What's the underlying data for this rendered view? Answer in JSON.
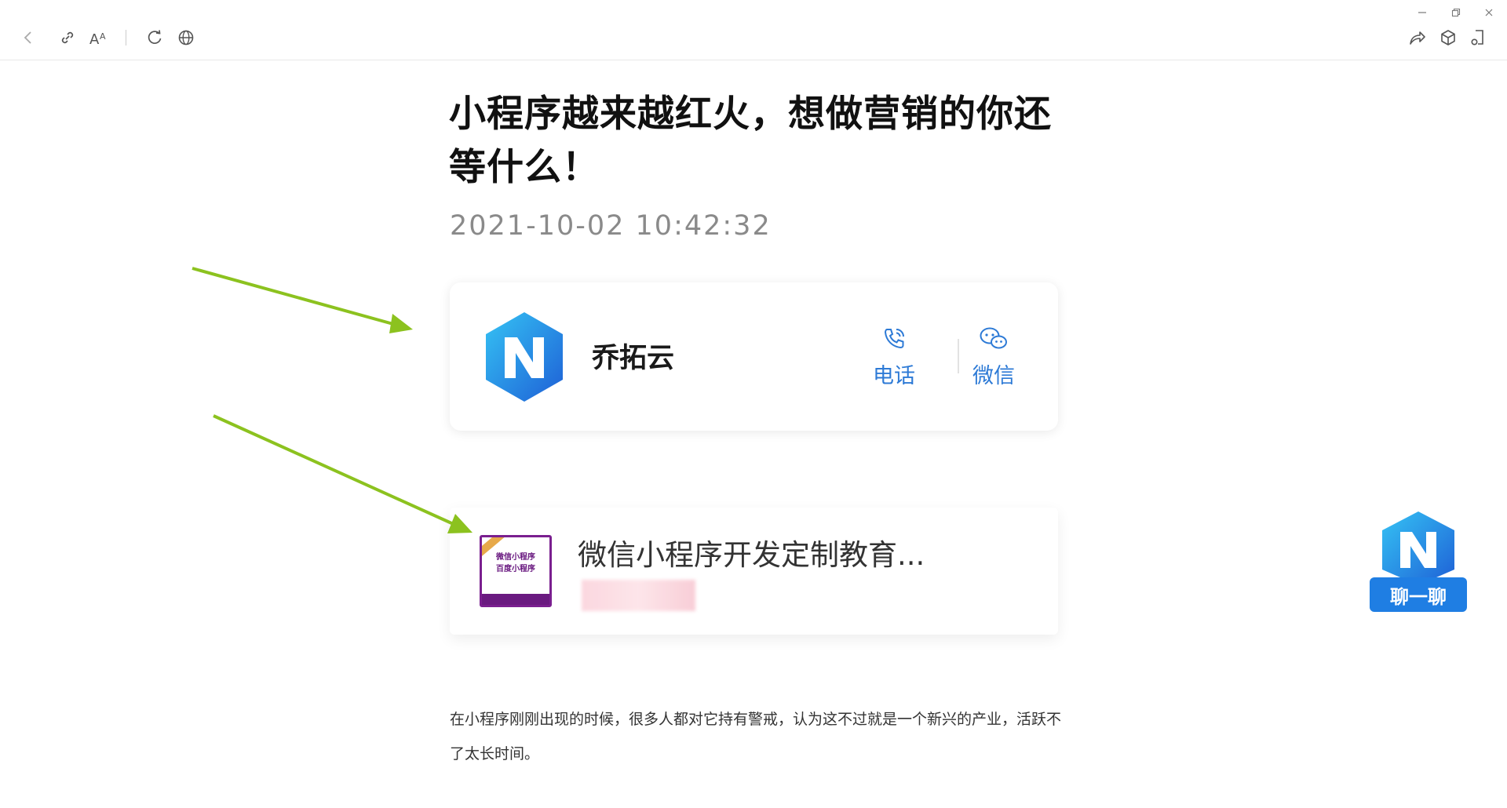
{
  "toolbar": {
    "left_icons": [
      "back-icon",
      "link-icon",
      "font-size-icon",
      "refresh-icon",
      "globe-icon"
    ],
    "right_icons": [
      "share-icon",
      "cube-icon",
      "mini-program-icon"
    ],
    "window_controls": [
      "minimize-icon",
      "restore-icon",
      "close-icon"
    ]
  },
  "article": {
    "title": "小程序越来越红火，想做营销的你还等什么！",
    "date": "2021-10-02 10:42:32",
    "paragraph": "在小程序刚刚出现的时候，很多人都对它持有警戒，认为这不过就是一个新兴的产业，活跃不了太长时间。"
  },
  "company_card": {
    "name": "乔拓云",
    "phone_label": "电话",
    "wechat_label": "微信",
    "accent": "#2d7ad6"
  },
  "product_card": {
    "name": "微信小程序开发定制教育...",
    "thumb_line1": "微信小程序",
    "thumb_line2": "百度小程序"
  },
  "chat_widget": {
    "label": "聊一聊",
    "color": "#1f7ee3"
  },
  "annotation_color": "#8cc21f"
}
